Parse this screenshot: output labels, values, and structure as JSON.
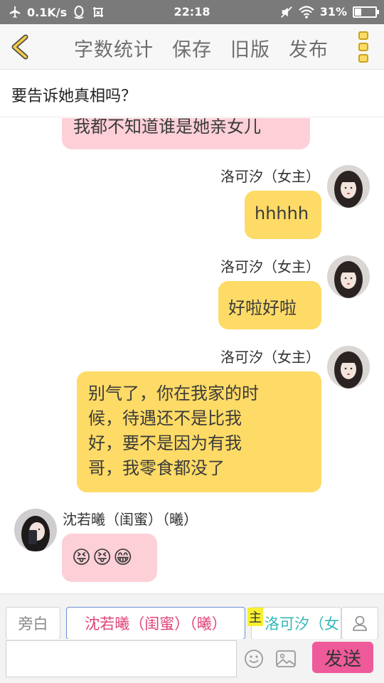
{
  "status_bar": {
    "net_speed": "0.1K/s",
    "time": "22:18",
    "battery": "31%",
    "battery_level": 0.31
  },
  "header": {
    "actions": [
      "字数统计",
      "保存",
      "旧版",
      "发布"
    ]
  },
  "title": "要告诉她真相吗？",
  "messages": [
    {
      "text": "我都不知道谁是她亲女儿"
    },
    {
      "sender": "洛可汐（女主）",
      "text": "hhhhh"
    },
    {
      "sender": "洛可汐（女主）",
      "text": "好啦好啦"
    },
    {
      "sender": "洛可汐（女主）",
      "lines": [
        "别气了，你在我家的时",
        "候，待遇还不是比我",
        "好，要不是因为有我",
        "哥，我零食都没了"
      ]
    },
    {
      "sender": "沈若曦（闺蜜）（曦）",
      "emojis": [
        "😝",
        "😝",
        "😁"
      ]
    }
  ],
  "roles": {
    "narration": "旁白",
    "friend": "沈若曦（闺蜜）（曦）",
    "main_tag": "主",
    "main": "洛可汐（女"
  },
  "input": {
    "value": "",
    "send_label": "发送"
  },
  "colors": {
    "bubble_yellow": "#fedb66",
    "bubble_pink": "#fdd0d8",
    "send_button": "#ef5a9a",
    "friend_role": "#e0457b",
    "main_role": "#35b8b6"
  }
}
